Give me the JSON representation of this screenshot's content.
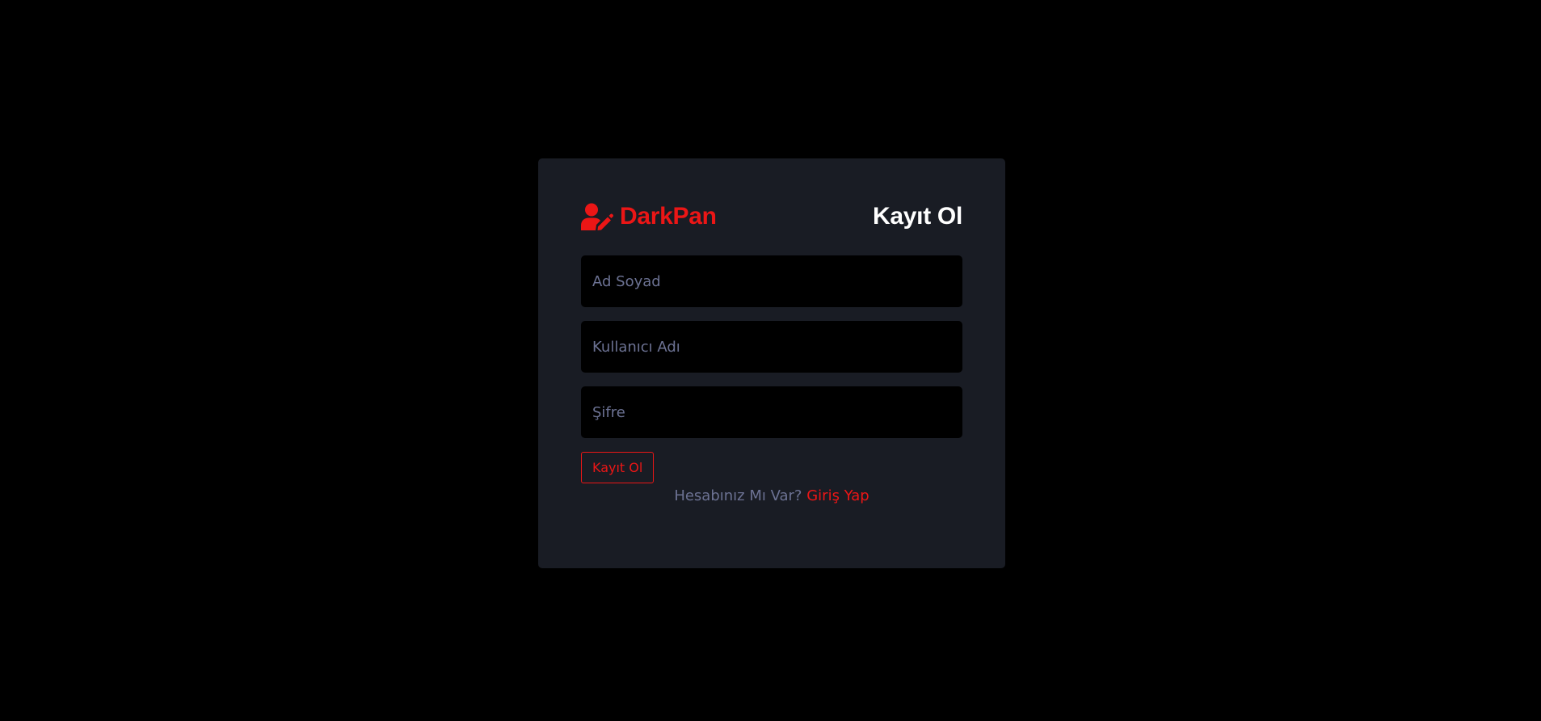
{
  "brand": {
    "name": "DarkPan",
    "icon": "user-edit-icon",
    "accent_color": "#eb1616"
  },
  "page": {
    "heading": "Kayıt Ol"
  },
  "form": {
    "full_name_placeholder": "Ad Soyad",
    "username_placeholder": "Kullanıcı Adı",
    "password_placeholder": "Şifre",
    "submit_label": "Kayıt Ol"
  },
  "footer": {
    "prompt": "Hesabınız Mı Var?",
    "link_label": "Giriş Yap"
  },
  "colors": {
    "background": "#000000",
    "card": "#191c24",
    "muted_text": "#6c7293",
    "heading_text": "#ffffff"
  }
}
